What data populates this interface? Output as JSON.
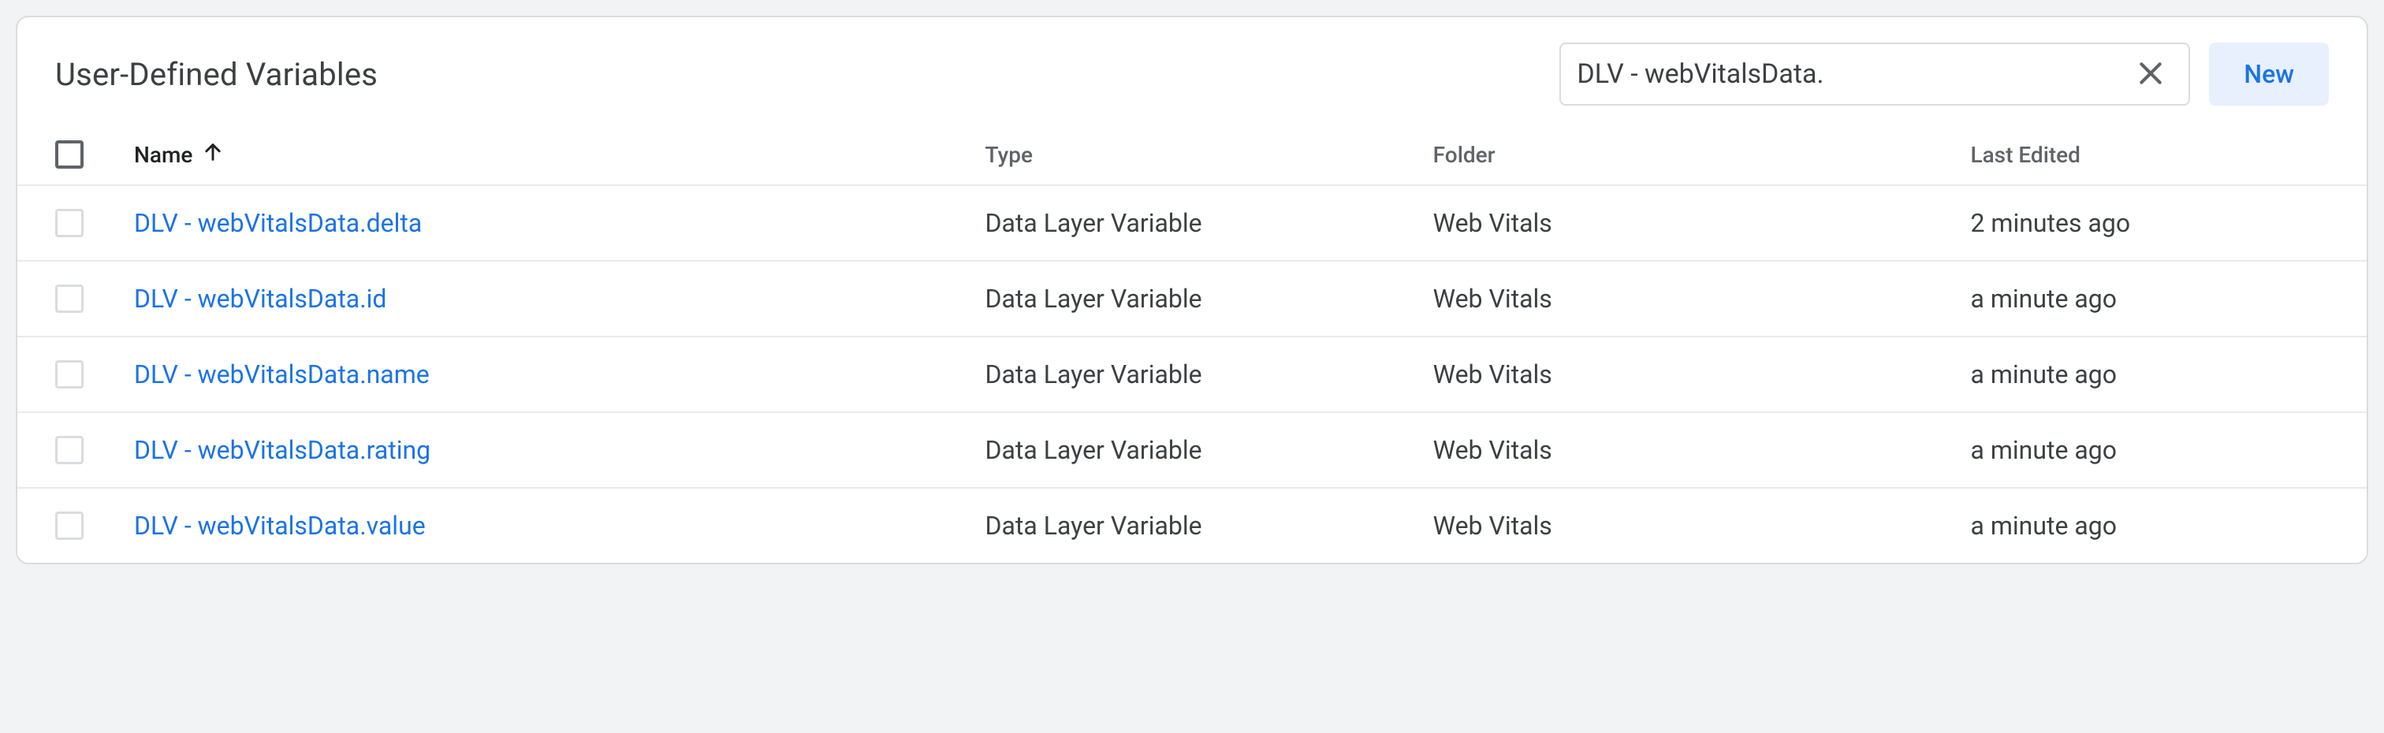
{
  "header": {
    "title": "User-Defined Variables",
    "search_value": "DLV - webVitalsData.",
    "new_label": "New"
  },
  "columns": {
    "name": "Name",
    "type": "Type",
    "folder": "Folder",
    "last_edited": "Last Edited"
  },
  "rows": [
    {
      "name": "DLV - webVitalsData.delta",
      "type": "Data Layer Variable",
      "folder": "Web Vitals",
      "last_edited": "2 minutes ago"
    },
    {
      "name": "DLV - webVitalsData.id",
      "type": "Data Layer Variable",
      "folder": "Web Vitals",
      "last_edited": "a minute ago"
    },
    {
      "name": "DLV - webVitalsData.name",
      "type": "Data Layer Variable",
      "folder": "Web Vitals",
      "last_edited": "a minute ago"
    },
    {
      "name": "DLV - webVitalsData.rating",
      "type": "Data Layer Variable",
      "folder": "Web Vitals",
      "last_edited": "a minute ago"
    },
    {
      "name": "DLV - webVitalsData.value",
      "type": "Data Layer Variable",
      "folder": "Web Vitals",
      "last_edited": "a minute ago"
    }
  ]
}
